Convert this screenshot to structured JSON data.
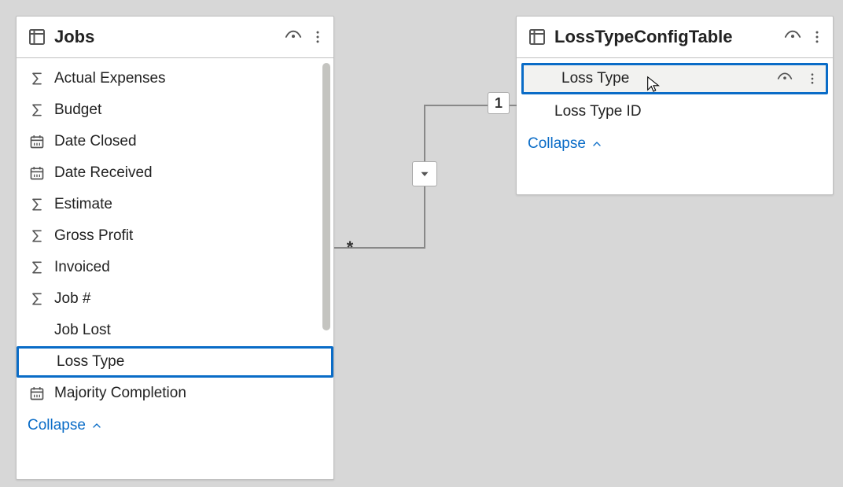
{
  "jobs": {
    "title": "Jobs",
    "collapse_label": "Collapse",
    "fields": {
      "actual_expenses": "Actual Expenses",
      "budget": "Budget",
      "date_closed": "Date Closed",
      "date_received": "Date Received",
      "estimate": "Estimate",
      "gross_profit": "Gross Profit",
      "invoiced": "Invoiced",
      "job_number": "Job #",
      "job_lost": "Job Lost",
      "loss_type": "Loss Type",
      "majority_completion": "Majority Completion"
    }
  },
  "loss_type_config": {
    "title": "LossTypeConfigTable",
    "collapse_label": "Collapse",
    "fields": {
      "loss_type": "Loss Type",
      "loss_type_id": "Loss Type ID"
    }
  },
  "relationship": {
    "many_label": "*",
    "one_label": "1"
  }
}
